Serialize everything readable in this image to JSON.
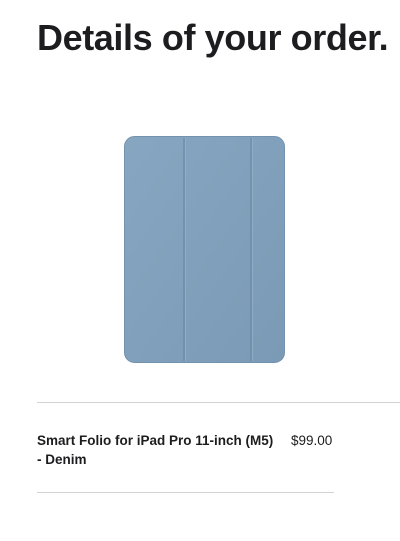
{
  "header": {
    "title": "Details of your order."
  },
  "order": {
    "items": [
      {
        "name": "Smart Folio for iPad Pro 11-inch (M5) - Denim",
        "price": "$99.00",
        "image_color": "#7f9fba"
      }
    ]
  },
  "colors": {
    "text": "#1d1d1f",
    "divider": "#d2d2d7",
    "background": "#ffffff"
  }
}
